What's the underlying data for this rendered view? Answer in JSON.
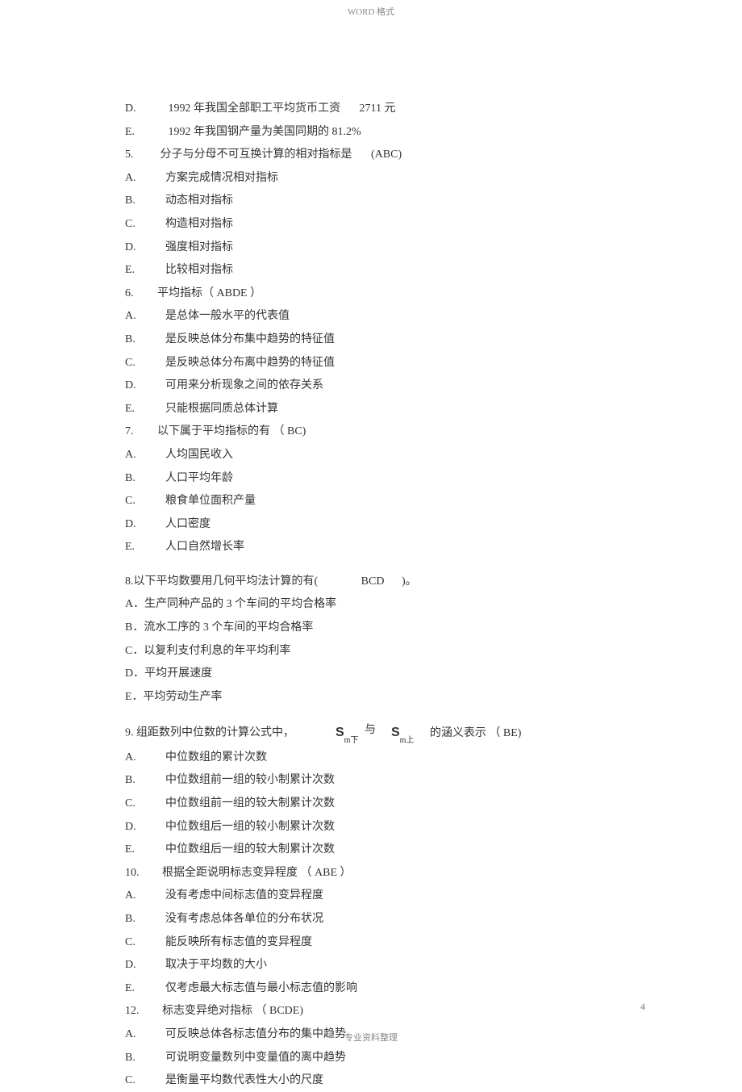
{
  "header": "WORD 格式",
  "footer": "专业资料整理",
  "page_number": "4",
  "lines": [
    {
      "label": "D.",
      "text": "1992 年我国全部职工平均货币工资",
      "tail": "2711 元"
    },
    {
      "label": "E.",
      "text": "1992 年我国钢产量为美国同期的 81.2%"
    },
    {
      "label": "5.",
      "text": "分子与分母不可互换计算的相对指标是",
      "answer": "(ABC)"
    },
    {
      "label": "A.",
      "text": "方案完成情况相对指标"
    },
    {
      "label": "B.",
      "text": "动态相对指标"
    },
    {
      "label": "C.",
      "text": "构造相对指标"
    },
    {
      "label": "D.",
      "text": "强度相对指标"
    },
    {
      "label": "E.",
      "text": "比较相对指标"
    },
    {
      "label": "6.",
      "text": "平均指标（ ABDE  ）"
    },
    {
      "label": "A.",
      "text": "是总体一般水平的代表值"
    },
    {
      "label": "B.",
      "text": "是反映总体分布集中趋势的特征值"
    },
    {
      "label": "C.",
      "text": "是反映总体分布离中趋势的特征值"
    },
    {
      "label": "D.",
      "text": "可用来分析现象之间的依存关系"
    },
    {
      "label": "E.",
      "text": "只能根据同质总体计算"
    },
    {
      "label": "7.",
      "text": "以下属于平均指标的有 （ BC)"
    },
    {
      "label": "A.",
      "text": "人均国民收入"
    },
    {
      "label": "B.",
      "text": "人口平均年龄"
    },
    {
      "label": "C.",
      "text": "粮食单位面积产量"
    },
    {
      "label": "D.",
      "text": "人口密度"
    },
    {
      "label": "E.",
      "text": "人口自然增长率"
    }
  ],
  "q8": {
    "stem": "8.以下平均数要用几何平均法计算的有(",
    "answer": "BCD",
    "stem_end": ")。",
    "opts": [
      "A．生产同种产品的  3 个车间的平均合格率",
      "B．流水工序的  3 个车间的平均合格率",
      "C．以复利支付利息的年平均利率",
      "D．平均开展速度",
      "E．平均劳动生产率"
    ]
  },
  "q9": {
    "stem_a": "9.  组距数列中位数的计算公式中，",
    "sym1": {
      "main": "S",
      "sub": "m下"
    },
    "mid": "与",
    "sym2": {
      "main": "S",
      "sub": "m上"
    },
    "stem_b": "的涵义表示 （ BE)",
    "opts": [
      {
        "label": "A.",
        "text": "中位数组的累计次数"
      },
      {
        "label": "B.",
        "text": "中位数组前一组的较小制累计次数"
      },
      {
        "label": "C.",
        "text": "中位数组前一组的较大制累计次数"
      },
      {
        "label": "D.",
        "text": "中位数组后一组的较小制累计次数"
      },
      {
        "label": "E.",
        "text": "中位数组后一组的较大制累计次数"
      }
    ]
  },
  "q10": {
    "label": "10.",
    "text": "根据全距说明标志变异程度 （ ABE  ）",
    "opts": [
      {
        "label": "A.",
        "text": "没有考虑中间标志值的变异程度"
      },
      {
        "label": "B.",
        "text": "没有考虑总体各单位的分布状况"
      },
      {
        "label": "C.",
        "text": "能反映所有标志值的变异程度"
      },
      {
        "label": "D.",
        "text": "取决于平均数的大小"
      },
      {
        "label": "E.",
        "text": "仅考虑最大标志值与最小标志值的影响"
      }
    ]
  },
  "q12": {
    "label": "12.",
    "text": "标志变异绝对指标 （ BCDE)",
    "opts": [
      {
        "label": "A.",
        "text": "可反映总体各标志值分布的集中趋势"
      },
      {
        "label": "B.",
        "text": "可说明变量数列中变量值的离中趋势"
      },
      {
        "label": "C.",
        "text": "是衡量平均数代表性大小的尺度"
      }
    ]
  }
}
